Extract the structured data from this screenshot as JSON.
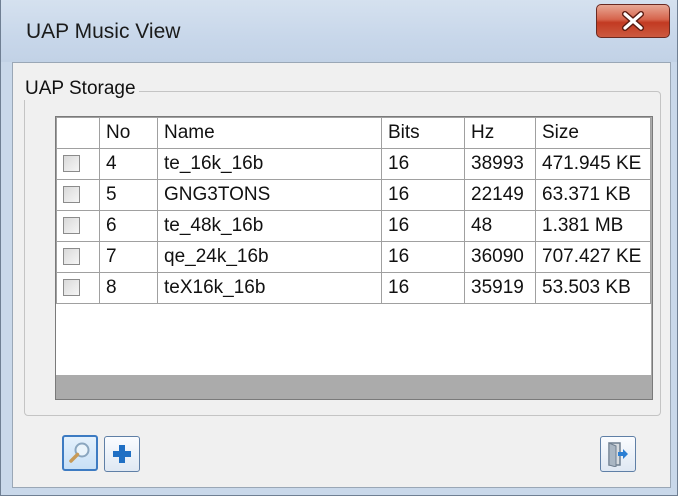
{
  "window": {
    "title": "UAP Music View"
  },
  "group": {
    "label": "UAP Storage"
  },
  "table": {
    "columns": [
      "",
      "No",
      "Name",
      "Bits",
      "Hz",
      "Size"
    ],
    "rows": [
      {
        "checked": false,
        "no": "4",
        "name": "te_16k_16b",
        "bits": "16",
        "hz": "38993",
        "size": "471.945 KE"
      },
      {
        "checked": false,
        "no": "5",
        "name": "GNG3TONS",
        "bits": "16",
        "hz": "22149",
        "size": "63.371 KB"
      },
      {
        "checked": false,
        "no": "6",
        "name": "te_48k_16b",
        "bits": "16",
        "hz": "48",
        "size": "1.381 MB"
      },
      {
        "checked": false,
        "no": "7",
        "name": "qe_24k_16b",
        "bits": "16",
        "hz": "36090",
        "size": "707.427 KE"
      },
      {
        "checked": false,
        "no": "8",
        "name": "teX16k_16b",
        "bits": "16",
        "hz": "35919",
        "size": "53.503 KB"
      }
    ]
  },
  "buttons": {
    "search_icon": "magnifier-icon",
    "add_icon": "plus-icon",
    "exit_icon": "exit-door-icon",
    "close_icon": "close-icon"
  },
  "colors": {
    "title_bar": "#c8d7ea",
    "close_button": "#c8452c",
    "grid_empty_area": "#ababab",
    "plus_icon": "#1f6fc4"
  }
}
